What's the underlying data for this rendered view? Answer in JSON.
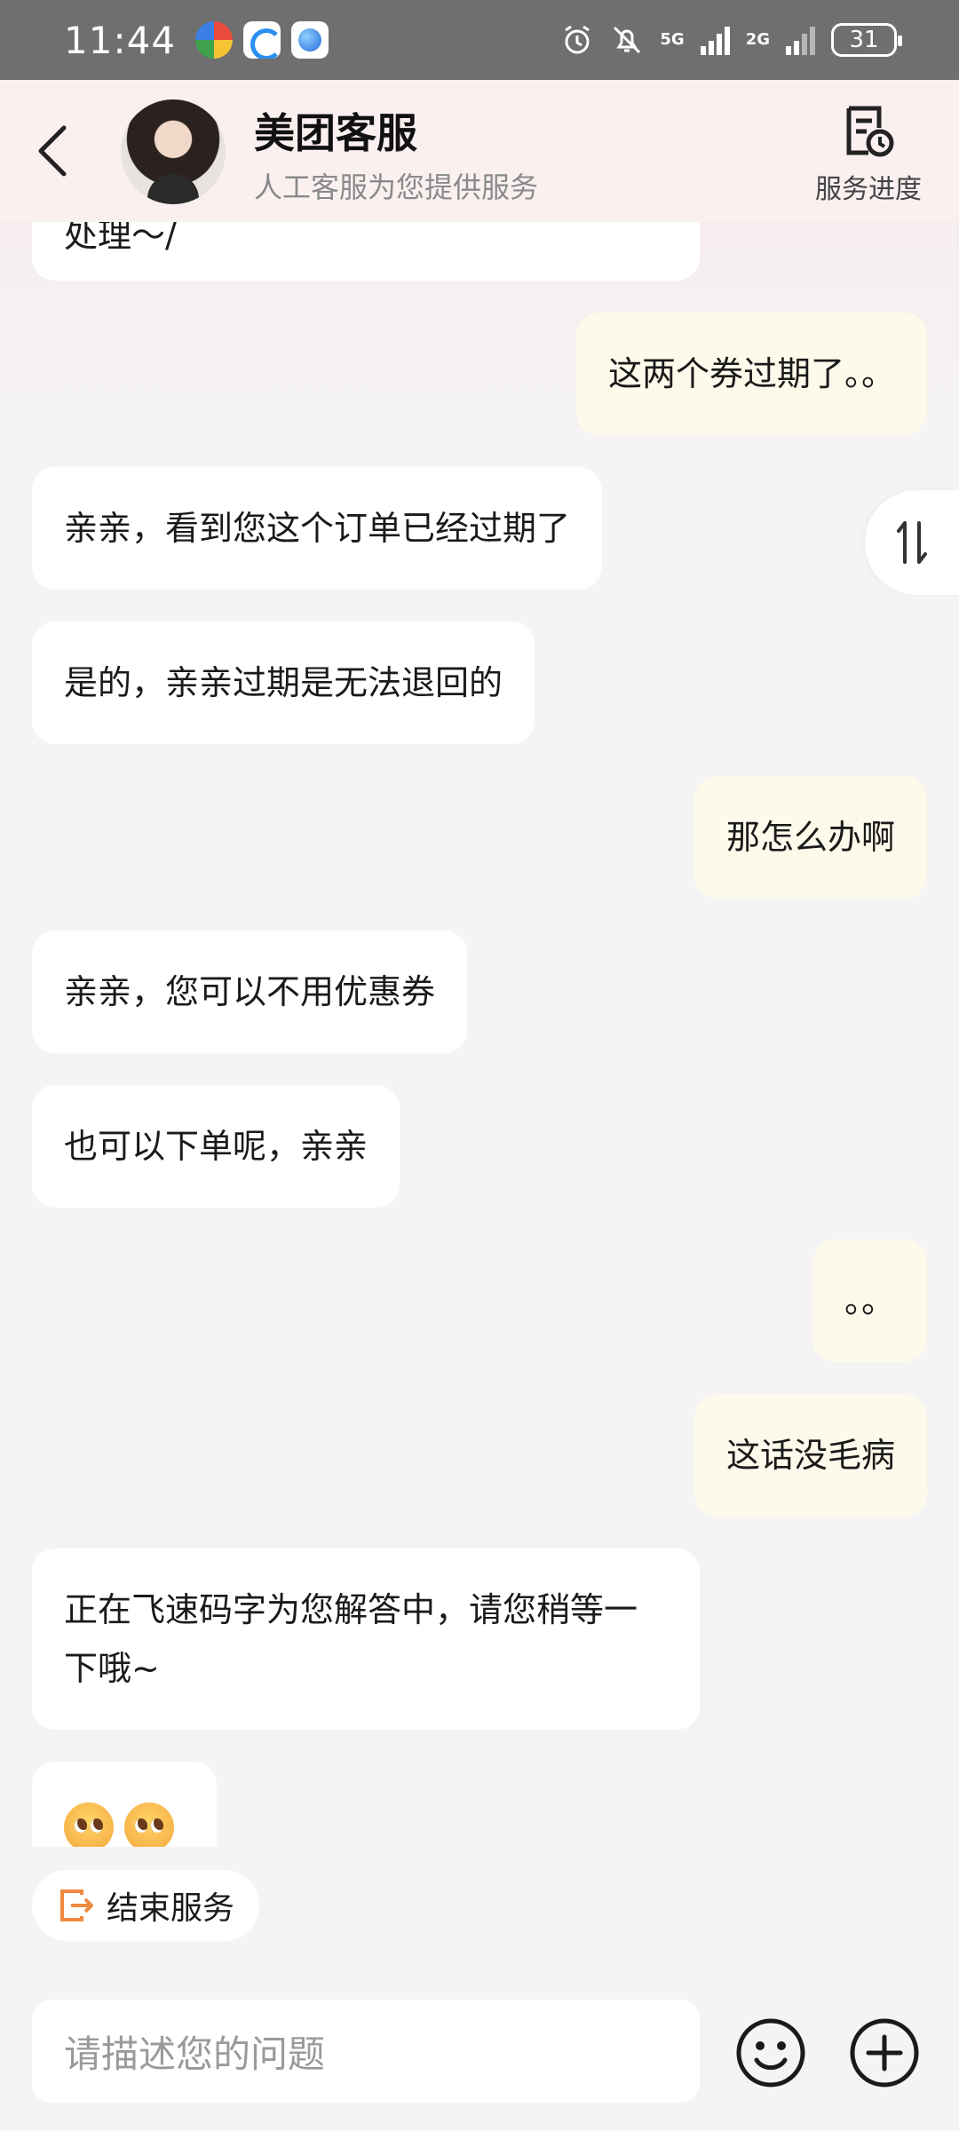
{
  "status_bar": {
    "time": "11:44",
    "network_primary": "5G",
    "network_secondary": "2G",
    "battery": "31"
  },
  "header": {
    "title": "美团客服",
    "subtitle": "人工客服为您提供服务",
    "progress_label": "服务进度"
  },
  "messages": [
    {
      "side": "in",
      "text": "处理～/"
    },
    {
      "side": "out",
      "text": "这两个券过期了。。"
    },
    {
      "side": "in",
      "text": "亲亲，看到您这个订单已经过期了"
    },
    {
      "side": "in",
      "text": "是的，亲亲过期是无法退回的"
    },
    {
      "side": "out",
      "text": "那怎么办啊"
    },
    {
      "side": "in",
      "text": "亲亲，您可以不用优惠券"
    },
    {
      "side": "in",
      "text": "也可以下单呢，亲亲"
    },
    {
      "side": "out",
      "text": "。。"
    },
    {
      "side": "out",
      "text": "这话没毛病"
    },
    {
      "side": "in",
      "text": "正在飞速码字为您解答中，请您稍等一下哦~"
    },
    {
      "side": "in",
      "text": "",
      "emoji": "pleading-face-emoji"
    }
  ],
  "end_service": {
    "label": "结束服务"
  },
  "input": {
    "placeholder": "请描述您的问题"
  },
  "colors": {
    "incoming_bubble": "#ffffff",
    "outgoing_bubble": "#fefaeb",
    "accent": "#f08a3e"
  }
}
